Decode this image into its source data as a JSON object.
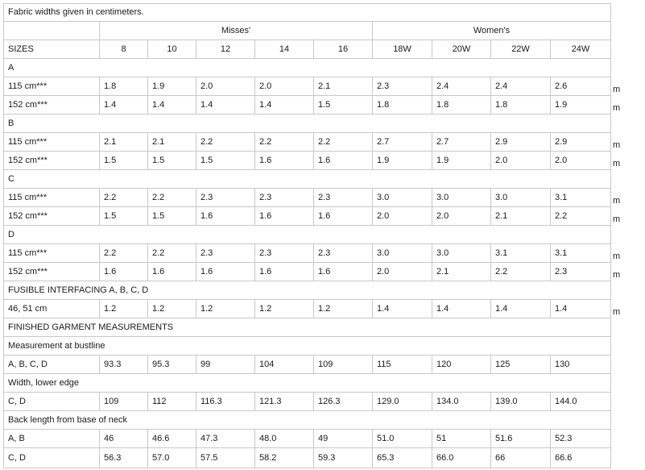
{
  "note": "Fabric widths given in centimeters.",
  "groups": [
    {
      "label": "Misses'"
    },
    {
      "label": "Women's"
    }
  ],
  "header": {
    "label": "SIZES",
    "sizes": [
      "8",
      "10",
      "12",
      "14",
      "16",
      "18W",
      "20W",
      "22W",
      "24W"
    ]
  },
  "rows": [
    {
      "kind": "section",
      "label": "A"
    },
    {
      "kind": "data",
      "label": "115 cm***",
      "values": [
        "1.8",
        "1.9",
        "2.0",
        "2.0",
        "2.1",
        "2.3",
        "2.4",
        "2.4",
        "2.6"
      ],
      "unit": "m"
    },
    {
      "kind": "data",
      "label": "152 cm***",
      "values": [
        "1.4",
        "1.4",
        "1.4",
        "1.4",
        "1.5",
        "1.8",
        "1.8",
        "1.8",
        "1.9"
      ],
      "unit": "m"
    },
    {
      "kind": "section",
      "label": "B"
    },
    {
      "kind": "data",
      "label": "115 cm***",
      "values": [
        "2.1",
        "2.1",
        "2.2",
        "2.2",
        "2.2",
        "2.7",
        "2.7",
        "2.9",
        "2.9"
      ],
      "unit": "m"
    },
    {
      "kind": "data",
      "label": "152 cm***",
      "values": [
        "1.5",
        "1.5",
        "1.5",
        "1.6",
        "1.6",
        "1.9",
        "1.9",
        "2.0",
        "2.0"
      ],
      "unit": "m"
    },
    {
      "kind": "section",
      "label": "C"
    },
    {
      "kind": "data",
      "label": "115 cm***",
      "values": [
        "2.2",
        "2.2",
        "2.3",
        "2.3",
        "2.3",
        "3.0",
        "3.0",
        "3.0",
        "3.1"
      ],
      "unit": "m"
    },
    {
      "kind": "data",
      "label": "152 cm***",
      "values": [
        "1.5",
        "1.5",
        "1.6",
        "1.6",
        "1.6",
        "2.0",
        "2.0",
        "2.1",
        "2.2"
      ],
      "unit": "m"
    },
    {
      "kind": "section",
      "label": "D"
    },
    {
      "kind": "data",
      "label": "115 cm***",
      "values": [
        "2.2",
        "2.2",
        "2.3",
        "2.3",
        "2.3",
        "3.0",
        "3.0",
        "3.1",
        "3.1"
      ],
      "unit": "m"
    },
    {
      "kind": "data",
      "label": "152 cm***",
      "values": [
        "1.6",
        "1.6",
        "1.6",
        "1.6",
        "1.6",
        "2.0",
        "2.1",
        "2.2",
        "2.3"
      ],
      "unit": "m"
    },
    {
      "kind": "section",
      "label": "FUSIBLE INTERFACING A, B, C, D"
    },
    {
      "kind": "data",
      "label": "46, 51 cm",
      "values": [
        "1.2",
        "1.2",
        "1.2",
        "1.2",
        "1.2",
        "1.4",
        "1.4",
        "1.4",
        "1.4"
      ],
      "unit": "m"
    },
    {
      "kind": "section",
      "label": "FINISHED GARMENT MEASUREMENTS"
    },
    {
      "kind": "section",
      "label": "Measurement at bustline"
    },
    {
      "kind": "data",
      "label": "A, B, C, D",
      "values": [
        "93.3",
        "95.3",
        "99",
        "104",
        "109",
        "115",
        "120",
        "125",
        "130"
      ],
      "unit": ""
    },
    {
      "kind": "section",
      "label": "Width, lower edge"
    },
    {
      "kind": "data",
      "label": "C, D",
      "values": [
        "109",
        "112",
        "116.3",
        "121.3",
        "126.3",
        "129.0",
        "134.0",
        "139.0",
        "144.0"
      ],
      "unit": ""
    },
    {
      "kind": "section",
      "label": "Back length from base of neck"
    },
    {
      "kind": "data",
      "label": "A, B",
      "values": [
        "46",
        "46.6",
        "47.3",
        "48.0",
        "49",
        "51.0",
        "51",
        "51.6",
        "52.3"
      ],
      "unit": ""
    },
    {
      "kind": "data",
      "label": "C, D",
      "values": [
        "56.3",
        "57.0",
        "57.5",
        "58.2",
        "59.3",
        "65.3",
        "66.0",
        "66",
        "66.6"
      ],
      "unit": ""
    }
  ]
}
